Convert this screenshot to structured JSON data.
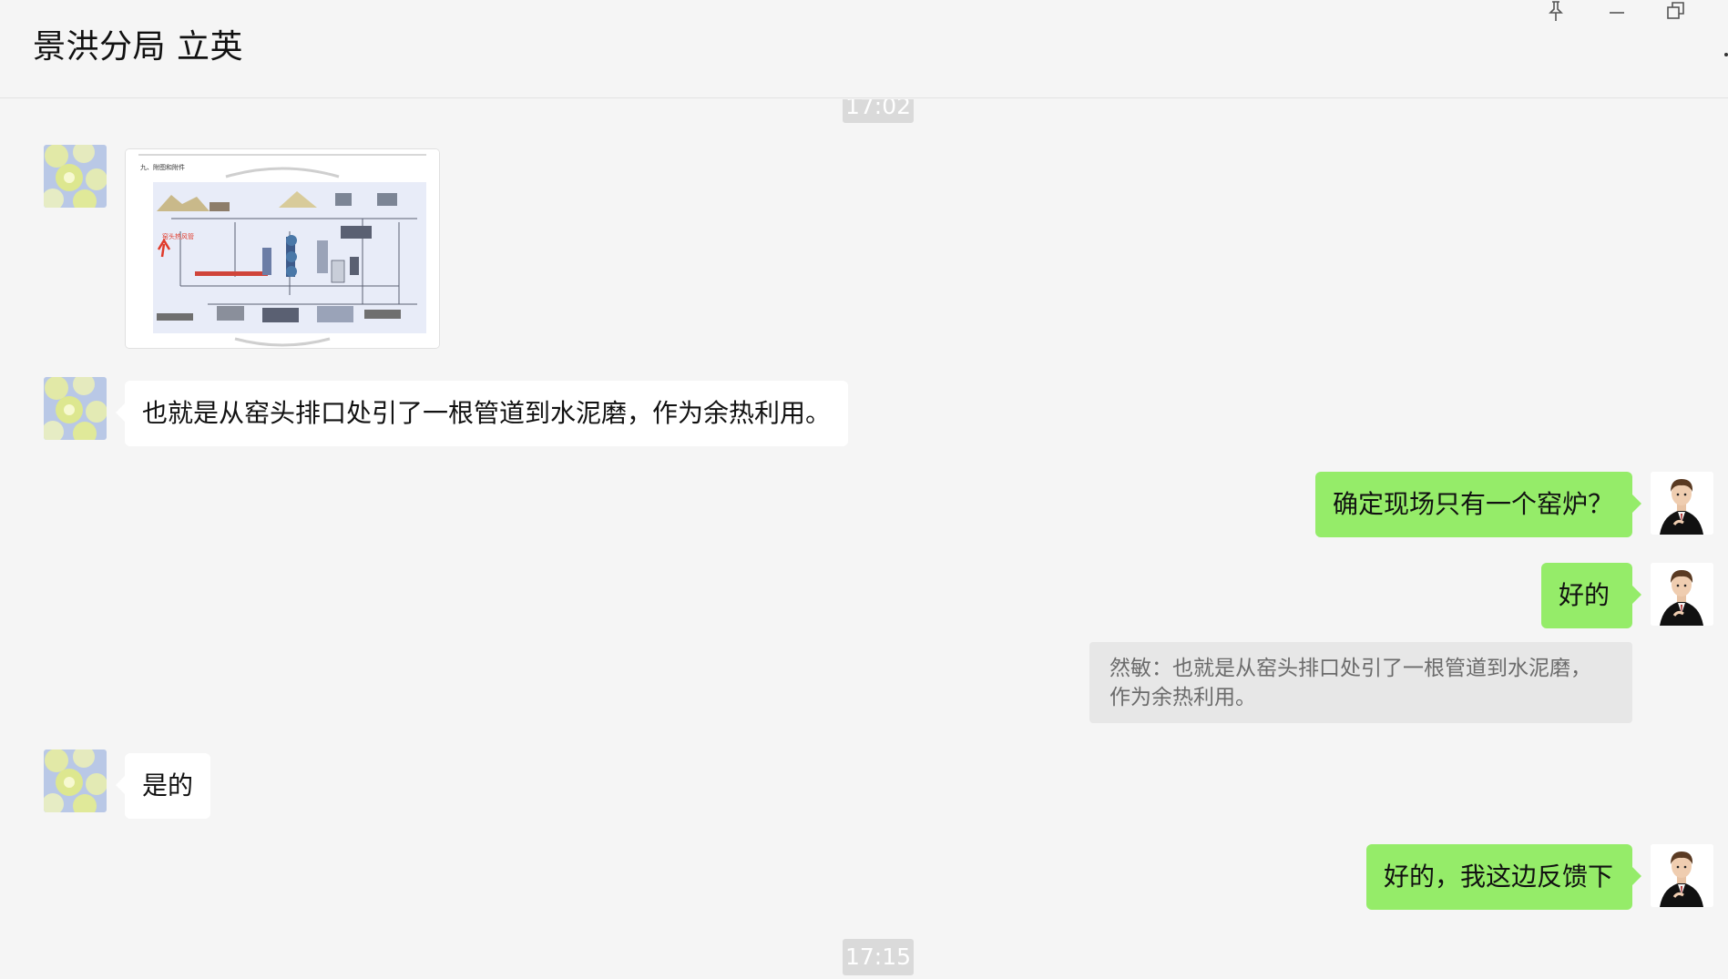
{
  "header": {
    "title": "景洪分局 立英",
    "pin_icon": "pin-icon",
    "minimize_icon": "minimize-icon",
    "restore_icon": "restore-window-icon"
  },
  "timestamps": [
    "17:02",
    "17:15"
  ],
  "messages": [
    {
      "side": "incoming",
      "type": "image",
      "icon": "process-flow-diagram-thumbnail",
      "diagram_heading": "九、附图和附件",
      "diagram_annotation": "窑头热风管"
    },
    {
      "side": "incoming",
      "type": "text",
      "text": "也就是从窑头排口处引了一根管道到水泥磨，作为余热利用。"
    },
    {
      "side": "outgoing",
      "type": "text",
      "text": "确定现场只有一个窑炉？"
    },
    {
      "side": "outgoing",
      "type": "text",
      "text": "好的"
    },
    {
      "side": "outgoing",
      "type": "quote",
      "text": "然敏：也就是从窑头排口处引了一根管道到水泥磨，\n作为余热利用。"
    },
    {
      "side": "incoming",
      "type": "text",
      "text": "是的"
    },
    {
      "side": "outgoing",
      "type": "text",
      "text": "好的，我这边反馈下"
    }
  ],
  "colors": {
    "background": "#f5f5f5",
    "outgoing_bubble": "#95ec69",
    "incoming_bubble": "#ffffff",
    "timestamp_chip": "#dadada",
    "quote_bg": "#e7e7e7"
  }
}
